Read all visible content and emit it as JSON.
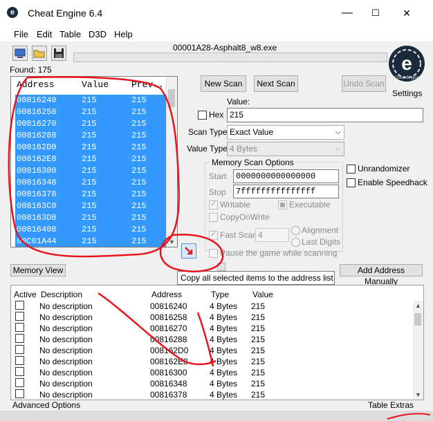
{
  "window": {
    "title": "Cheat Engine 6.4",
    "minimize": "—",
    "maximize": "☐",
    "close": "✕"
  },
  "menu": [
    "File",
    "Edit",
    "Table",
    "D3D",
    "Help"
  ],
  "toolbar": {
    "icons": [
      "open-process-icon",
      "open-file-icon",
      "save-icon"
    ]
  },
  "process_name": "00001A28-Asphalt8_w8.exe",
  "found_label": "Found: 175",
  "logo": {
    "letter": "e",
    "brand": "Cheat Engine"
  },
  "settings_label": "Settings",
  "results": {
    "headers": {
      "address": "Address",
      "value": "Value",
      "previous": "Prev..."
    },
    "rows": [
      {
        "address": "00816240",
        "value": "215",
        "previous": "215"
      },
      {
        "address": "00816258",
        "value": "215",
        "previous": "215"
      },
      {
        "address": "00816270",
        "value": "215",
        "previous": "215"
      },
      {
        "address": "00816288",
        "value": "215",
        "previous": "215"
      },
      {
        "address": "008162D0",
        "value": "215",
        "previous": "215"
      },
      {
        "address": "008162E8",
        "value": "215",
        "previous": "215"
      },
      {
        "address": "00816300",
        "value": "215",
        "previous": "215"
      },
      {
        "address": "00816348",
        "value": "215",
        "previous": "215"
      },
      {
        "address": "00816378",
        "value": "215",
        "previous": "215"
      },
      {
        "address": "008163C0",
        "value": "215",
        "previous": "215"
      },
      {
        "address": "008163D8",
        "value": "215",
        "previous": "215"
      },
      {
        "address": "00816408",
        "value": "215",
        "previous": "215"
      },
      {
        "address": "00C01A44",
        "value": "215",
        "previous": "215"
      }
    ]
  },
  "scan": {
    "new_scan": "New Scan",
    "next_scan": "Next Scan",
    "undo_scan": "Undo Scan",
    "value_label": "Value:",
    "hex_label": "Hex",
    "value": "215",
    "scan_type_label": "Scan Type",
    "scan_type": "Exact Value",
    "value_type_label": "Value Type",
    "value_type": "4 Bytes"
  },
  "memory_options": {
    "title": "Memory Scan Options",
    "start_label": "Start",
    "start": "0000000000000000",
    "stop_label": "Stop",
    "stop": "7fffffffffffffff",
    "writable": "Writable",
    "executable": "Executable",
    "copy_on_write": "CopyOnWrite",
    "fast_scan": "Fast Scan",
    "fast_scan_value": "4",
    "alignment": "Alignment",
    "last_digits": "Last Digits",
    "pause": "Pause the game while scanning"
  },
  "right_options": {
    "unrandomizer": "Unrandomizer",
    "speedhack": "Enable Speedhack"
  },
  "memory_view_button": "Memory View",
  "add_address_button": "Add Address Manually",
  "tooltip": "Copy all selected items to the address list",
  "address_list": {
    "headers": {
      "active": "Active",
      "description": "Description",
      "address": "Address",
      "type": "Type",
      "value": "Value"
    },
    "rows": [
      {
        "description": "No description",
        "address": "00816240",
        "type": "4 Bytes",
        "value": "215"
      },
      {
        "description": "No description",
        "address": "00816258",
        "type": "4 Bytes",
        "value": "215"
      },
      {
        "description": "No description",
        "address": "00816270",
        "type": "4 Bytes",
        "value": "215"
      },
      {
        "description": "No description",
        "address": "00816288",
        "type": "4 Bytes",
        "value": "215"
      },
      {
        "description": "No description",
        "address": "008162D0",
        "type": "4 Bytes",
        "value": "215"
      },
      {
        "description": "No description",
        "address": "008162E8",
        "type": "4 Bytes",
        "value": "215"
      },
      {
        "description": "No description",
        "address": "00816300",
        "type": "4 Bytes",
        "value": "215"
      },
      {
        "description": "No description",
        "address": "00816348",
        "type": "4 Bytes",
        "value": "215"
      },
      {
        "description": "No description",
        "address": "00816378",
        "type": "4 Bytes",
        "value": "215"
      }
    ]
  },
  "status": {
    "advanced": "Advanced Options",
    "extras": "Table Extras"
  },
  "colors": {
    "selection": "#3399ff",
    "annotation": "#e8141b",
    "logo": "#1b2a3a"
  }
}
